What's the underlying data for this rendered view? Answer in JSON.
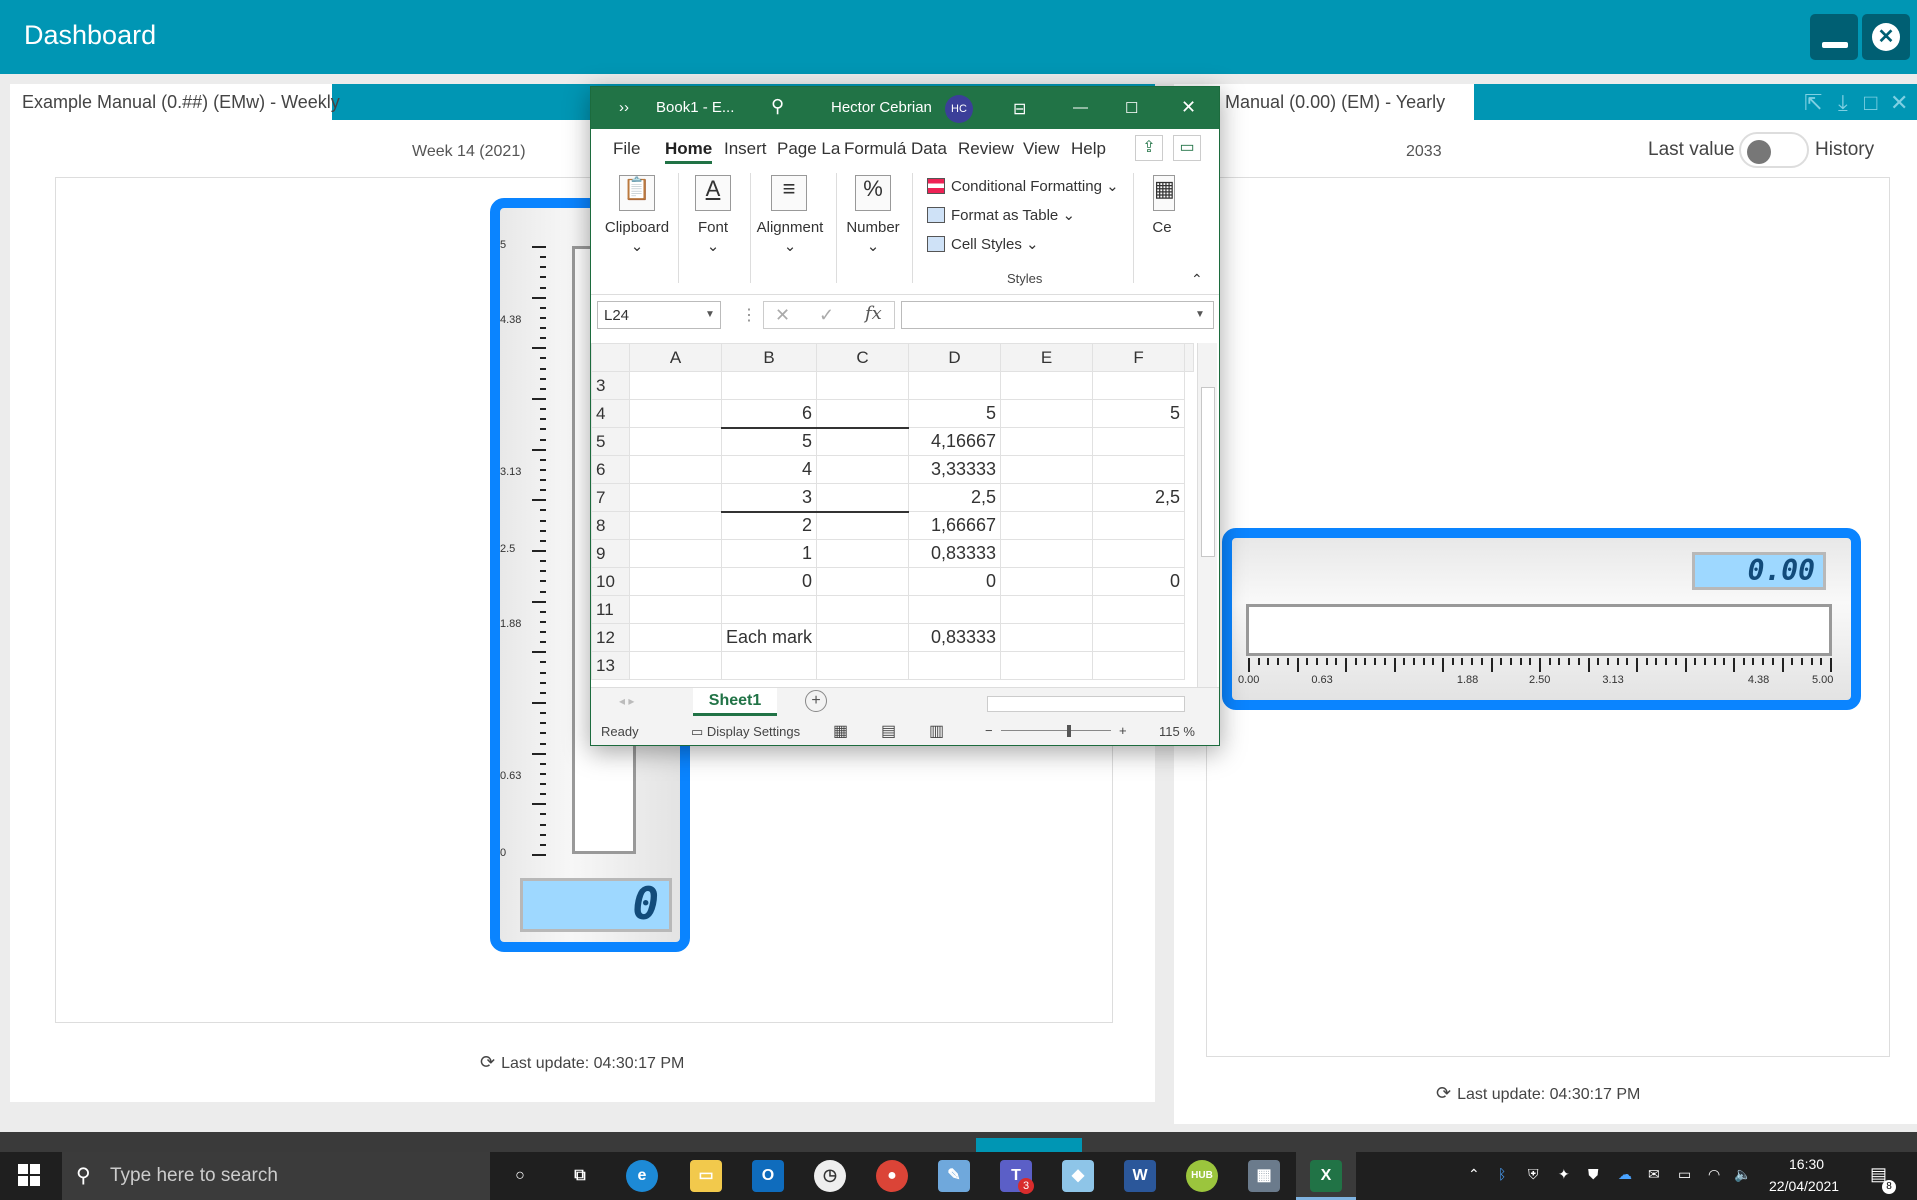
{
  "header": {
    "title": "Dashboard"
  },
  "left_widget": {
    "tab_label": "Example Manual (0.##) (EMw) - Weekly",
    "period": "Week 14 (2021)",
    "gauge": {
      "scale_labels": [
        "5",
        "4.38",
        "3.13",
        "2.5",
        "1.88",
        "0.63",
        "0"
      ],
      "value_display": "0",
      "fill_fraction": 0
    },
    "last_update": "Last update: 04:30:17 PM"
  },
  "right_widget": {
    "tab_label": "nple Manual (0.00) (EM) - Yearly",
    "period": "2033",
    "toggle_left": "Last value",
    "toggle_right": "History",
    "gauge": {
      "scale_labels": [
        "0.00",
        "0.63",
        "1.88",
        "2.50",
        "3.13",
        "4.38",
        "5.00"
      ],
      "value_display": "0.00",
      "fill_fraction": 0
    },
    "last_update": "Last update: 04:30:17 PM"
  },
  "excel": {
    "title": "Book1 - E...",
    "user": "Hector Cebrian",
    "user_initials": "HC",
    "menu": [
      "File",
      "Home",
      "Insert",
      "Page La",
      "Formulá",
      "Data",
      "Review",
      "View",
      "Help"
    ],
    "ribbon": {
      "clipboard": "Clipboard",
      "font": "Font",
      "alignment": "Alignment",
      "number": "Number",
      "conditional_formatting": "Conditional Formatting",
      "format_as_table": "Format as Table",
      "cell_styles": "Cell Styles",
      "styles_group": "Styles",
      "cells": "Ce"
    },
    "name_box": "L24",
    "columns": [
      "A",
      "B",
      "C",
      "D",
      "E",
      "F"
    ],
    "rows": [
      {
        "n": "3",
        "b": "",
        "d": "",
        "f": ""
      },
      {
        "n": "4",
        "b": "6",
        "d": "5",
        "f": "5"
      },
      {
        "n": "5",
        "b": "5",
        "d": "4,16667",
        "f": ""
      },
      {
        "n": "6",
        "b": "4",
        "d": "3,33333",
        "f": ""
      },
      {
        "n": "7",
        "b": "3",
        "d": "2,5",
        "f": "2,5"
      },
      {
        "n": "8",
        "b": "2",
        "d": "1,66667",
        "f": ""
      },
      {
        "n": "9",
        "b": "1",
        "d": "0,83333",
        "f": ""
      },
      {
        "n": "10",
        "b": "0",
        "d": "0",
        "f": "0"
      },
      {
        "n": "11",
        "b": "",
        "d": "",
        "f": ""
      },
      {
        "n": "12",
        "b": "Each mark",
        "d": "0,83333",
        "f": ""
      },
      {
        "n": "13",
        "b": "",
        "d": "",
        "f": ""
      }
    ],
    "sheet_tab": "Sheet1",
    "status": "Ready",
    "display_settings": "Display Settings",
    "zoom": "115 %"
  },
  "taskbar": {
    "search_placeholder": "Type here to search",
    "time": "16:30",
    "date": "22/04/2021",
    "teams_badge": "3",
    "notification_count": "8"
  },
  "colors": {
    "teal": "#0096b4",
    "gauge_blue": "#0a84ff",
    "lcd": "#9ed8ff",
    "excel_green": "#217346"
  }
}
